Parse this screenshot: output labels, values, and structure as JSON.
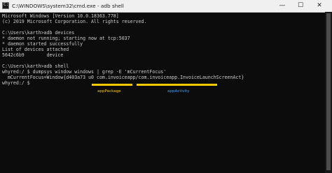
{
  "window": {
    "title": "C:\\WINDOWS\\system32\\cmd.exe - adb  shell",
    "minimize_glyph": "—",
    "maximize_glyph": "☐",
    "close_glyph": "✕"
  },
  "console": {
    "lines": [
      "Microsoft Windows [Version 10.0.18363.778]",
      "(c) 2019 Microsoft Corporation. All rights reserved.",
      "",
      "C:\\Users\\karth>adb devices",
      "* daemon not running; starting now at tcp:5037",
      "* daemon started successfully",
      "List of devices attached",
      "5642c6b9        device",
      "",
      "C:\\Users\\karth>adb shell",
      "whyred:/ $ dumpsys window windows | grep -E 'mCurrentFocus'",
      "  mCurrentFocus=Window{d403a73 u0 com.invoiceapp/com.invoiceapp.InvoiceLaunchScreenAct}",
      "whyred:/ $"
    ]
  },
  "annotations": {
    "app_package": "appPackage",
    "app_activity": "appActivity",
    "underline_color": "#f5c800",
    "package_label_color": "#f5c800",
    "activity_label_color": "#3aa0ff"
  },
  "colors": {
    "console_background": "#0c0c0c",
    "console_text": "#cccccc",
    "titlebar_background": "#f0f0f0"
  }
}
